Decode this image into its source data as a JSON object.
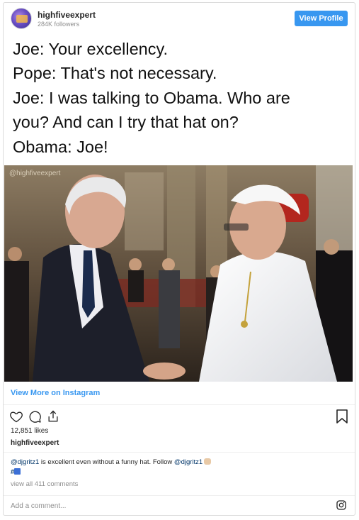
{
  "header": {
    "username": "highfiveexpert",
    "followers": "284K followers",
    "view_profile_label": "View Profile"
  },
  "post": {
    "meme_lines": [
      "Joe: Your excellency.",
      "Pope: That's not necessary.",
      "Joe: I was talking to Obama. Who are",
      "you? And can I try that hat on?",
      "Obama: Joe!"
    ],
    "watermark": "@highfiveexpert",
    "view_more_label": "View More on Instagram"
  },
  "actions": {
    "icons": [
      "heart-icon",
      "comment-icon",
      "share-icon",
      "bookmark-icon"
    ]
  },
  "stats": {
    "likes": "12,851 likes"
  },
  "caption": {
    "username": "highfiveexpert",
    "mention_1": "@djgritz1",
    "text_1": " is excellent even without a funny hat. Follow ",
    "mention_2": "@djgritz1",
    "hashtag_prefix": "#"
  },
  "comments": {
    "view_all_label": "view all 411 comments",
    "add_comment_placeholder": "Add a comment..."
  },
  "colors": {
    "accent": "#3897f0",
    "border": "#dbdbdb",
    "muted": "#8e8e8e",
    "text": "#262626"
  }
}
